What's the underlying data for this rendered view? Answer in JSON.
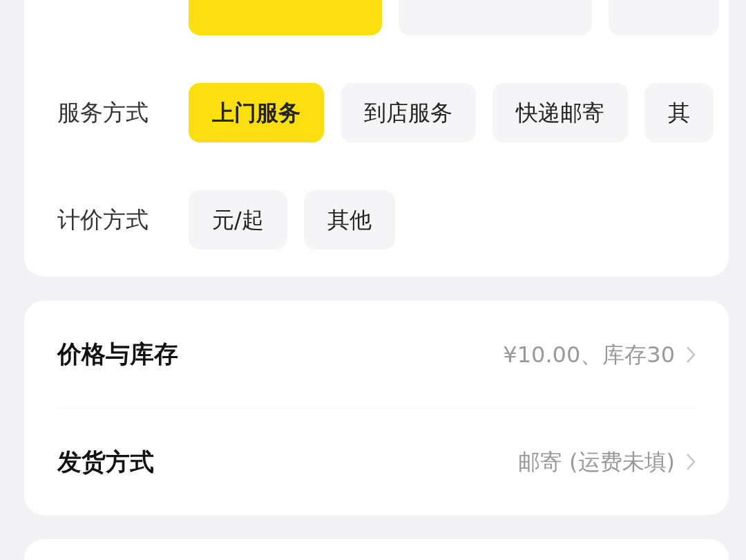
{
  "option_groups": [
    {
      "options": [
        {
          "selected": true
        },
        {
          "selected": false
        },
        {
          "selected": false
        }
      ]
    },
    {
      "label": "服务方式",
      "options": [
        {
          "label": "上门服务",
          "selected": true
        },
        {
          "label": "到店服务",
          "selected": false
        },
        {
          "label": "快递邮寄",
          "selected": false
        },
        {
          "label": "其",
          "selected": false
        }
      ]
    },
    {
      "label": "计价方式",
      "options": [
        {
          "label": "元/起",
          "selected": false
        },
        {
          "label": "其他",
          "selected": false
        }
      ]
    }
  ],
  "settings": [
    {
      "title": "价格与库存",
      "value": "¥10.00、库存30"
    },
    {
      "title": "发货方式",
      "value": "邮寄 (运费未填)"
    }
  ]
}
